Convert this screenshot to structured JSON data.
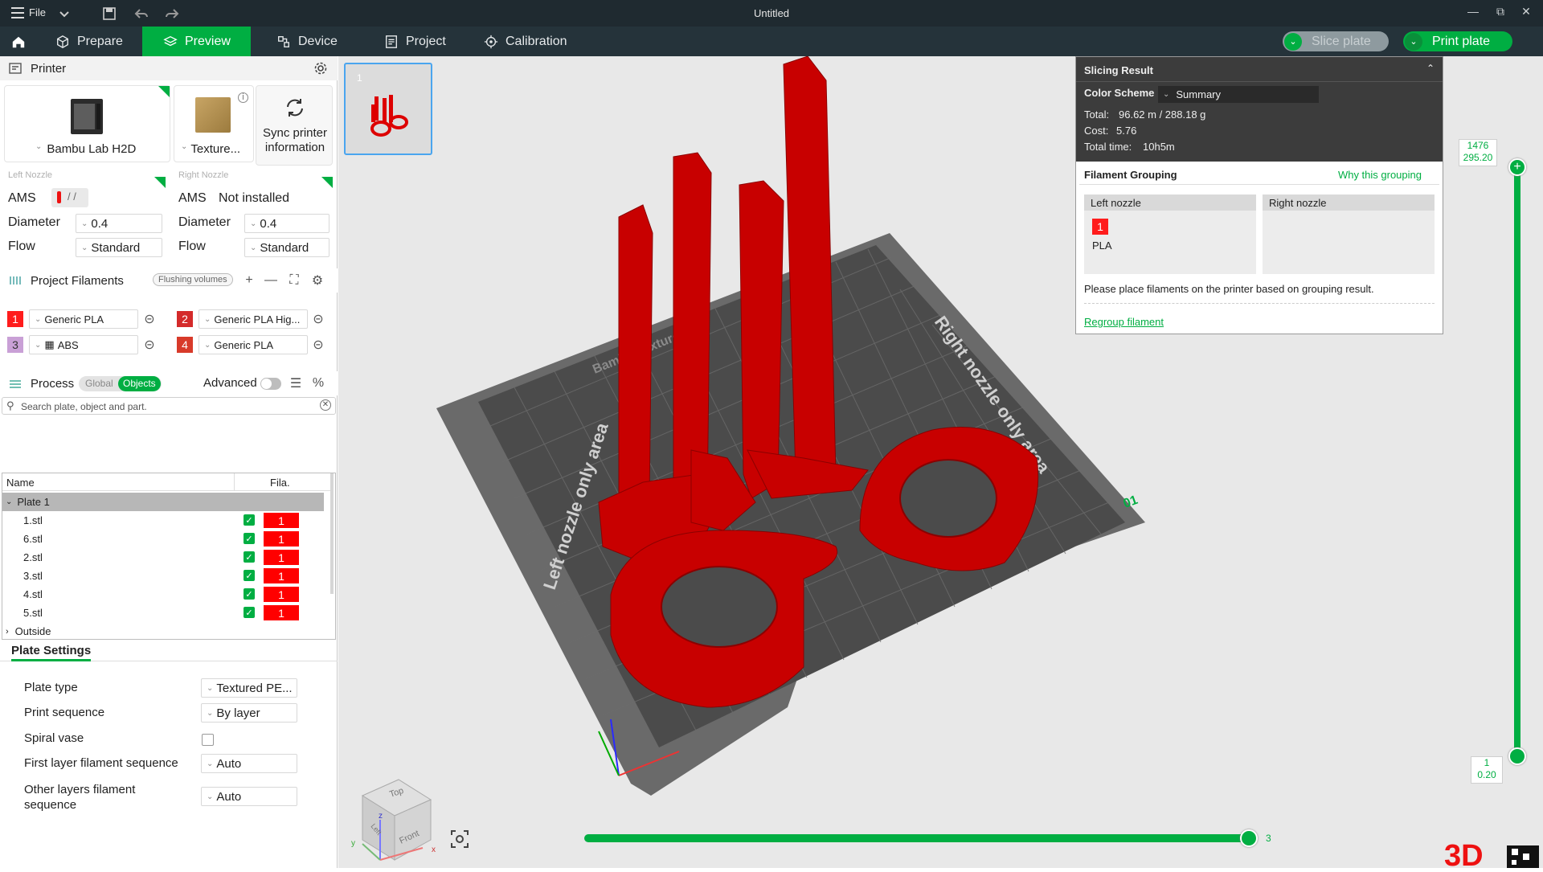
{
  "titlebar": {
    "file_label": "File",
    "title": "Untitled"
  },
  "tabs": [
    {
      "label": "Prepare",
      "icon": "cube-icon"
    },
    {
      "label": "Preview",
      "icon": "layers-icon",
      "active": true
    },
    {
      "label": "Device",
      "icon": "device-icon"
    },
    {
      "label": "Project",
      "icon": "project-icon"
    },
    {
      "label": "Calibration",
      "icon": "calibration-icon"
    }
  ],
  "actions": {
    "slice_label": "Slice plate",
    "print_label": "Print plate"
  },
  "printer": {
    "section_title": "Printer",
    "name": "Bambu Lab H2D",
    "plate": "Texture...",
    "sync_label_1": "Sync printer",
    "sync_label_2": "information",
    "left_nozzle": {
      "title": "Left Nozzle",
      "ams_label": "AMS",
      "diameter_label": "Diameter",
      "diameter": "0.4",
      "flow_label": "Flow",
      "flow": "Standard"
    },
    "right_nozzle": {
      "title": "Right Nozzle",
      "ams_label": "AMS",
      "ams_value": "Not installed",
      "diameter_label": "Diameter",
      "diameter": "0.4",
      "flow_label": "Flow",
      "flow": "Standard"
    }
  },
  "filaments": {
    "section_title": "Project Filaments",
    "flushing_label": "Flushing volumes",
    "items": [
      {
        "index": "1",
        "name": "Generic PLA",
        "color": "#ff1c1c"
      },
      {
        "index": "2",
        "name": "Generic PLA Hig...",
        "color": "#d42a2a"
      },
      {
        "index": "3",
        "name": "ABS",
        "color": "#c9a0d6"
      },
      {
        "index": "4",
        "name": "Generic PLA",
        "color": "#d83a2a"
      }
    ]
  },
  "process": {
    "section_title": "Process",
    "toggle_global": "Global",
    "toggle_objects": "Objects",
    "advanced_label": "Advanced",
    "search_placeholder": "Search plate, object and part.",
    "col_name": "Name",
    "col_fila": "Fila.",
    "plate_label": "Plate 1",
    "objects": [
      {
        "name": "1.stl",
        "fila": "1"
      },
      {
        "name": "6.stl",
        "fila": "1"
      },
      {
        "name": "2.stl",
        "fila": "1"
      },
      {
        "name": "3.stl",
        "fila": "1"
      },
      {
        "name": "4.stl",
        "fila": "1"
      },
      {
        "name": "5.stl",
        "fila": "1"
      }
    ],
    "outside_label": "Outside"
  },
  "plate_settings": {
    "title": "Plate Settings",
    "rows": [
      {
        "label": "Plate type",
        "value": "Textured PE..."
      },
      {
        "label": "Print sequence",
        "value": "By layer"
      },
      {
        "label": "Spiral vase",
        "value": ""
      },
      {
        "label": "First layer filament sequence",
        "value": "Auto"
      },
      {
        "label_1": "Other layers filament",
        "label_2": "sequence",
        "value": "Auto"
      }
    ]
  },
  "viewport": {
    "plate_number": "1",
    "bed_label_left": "Left nozzle only area",
    "bed_label_right": "Right nozzle only area",
    "bed_label_brand": "Bambu Textured PEI",
    "bed_number": "01",
    "cube_top": "Top",
    "cube_front": "Front",
    "cube_left": "Left",
    "axis_x": "x",
    "axis_y": "y",
    "axis_z": "z"
  },
  "slicing_result": {
    "title": "Slicing Result",
    "color_scheme_label": "Color Scheme",
    "color_scheme_value": "Summary",
    "total_label": "Total:",
    "total_value": "96.62 m / 288.18 g",
    "cost_label": "Cost:",
    "cost_value": "5.76",
    "time_label": "Total time:",
    "time_value": "10h5m",
    "grouping_title": "Filament Grouping",
    "why_label": "Why this grouping",
    "left_nozzle": "Left nozzle",
    "right_nozzle": "Right nozzle",
    "group_fila_index": "1",
    "group_fila_type": "PLA",
    "hint": "Please place filaments on the printer based on grouping result.",
    "regroup_label": "Regroup filament"
  },
  "layers": {
    "top_layer": "1476",
    "top_height": "295.20",
    "bottom_layer": "1",
    "bottom_height": "0.20",
    "move_value": "3"
  },
  "colors": {
    "accent": "#00ae42",
    "model": "#cc0000",
    "dark_bar": "#25333a"
  }
}
